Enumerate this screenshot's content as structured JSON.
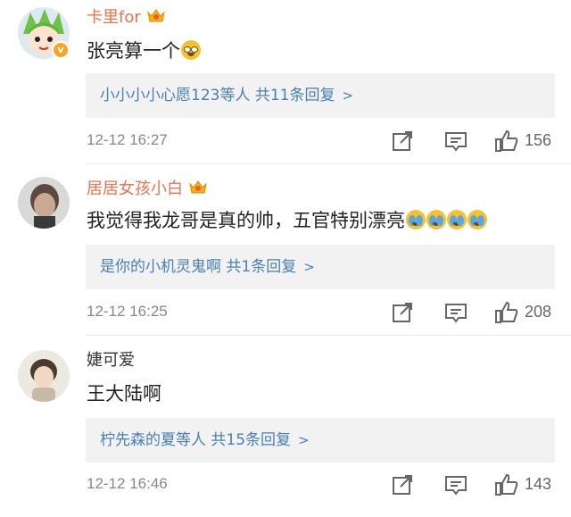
{
  "comments": [
    {
      "username": "卡里for",
      "content": "张亮算一个",
      "replies": "小小小小心愿123等人  共11条回复",
      "time": "12-12 16:27",
      "likes": "156",
      "emoji": [
        "nerd-face"
      ]
    },
    {
      "username": "居居女孩小白",
      "content": "我觉得我龙哥是真的帅，五官特别漂亮",
      "replies": "是你的小机灵鬼啊  共1条回复",
      "time": "12-12 16:25",
      "likes": "208",
      "emoji": [
        "crying-face",
        "crying-face",
        "crying-face",
        "crying-face"
      ]
    },
    {
      "username": "婕可爱",
      "content": "王大陆啊",
      "replies": "柠先森的夏等人  共15条回复",
      "time": "12-12 16:46",
      "likes": "143",
      "emoji": []
    }
  ],
  "icons": {
    "share": "share-icon",
    "comment": "comment-icon",
    "like": "thumbs-up-icon",
    "chevron": "chevron-right-icon",
    "vip": "crown-badge-icon",
    "verified": "verified-badge-icon"
  },
  "colors": {
    "username_vip": "#eb7350",
    "link": "#4a7fb4",
    "reply_bg": "#f2f2f2",
    "meta": "#888888"
  }
}
